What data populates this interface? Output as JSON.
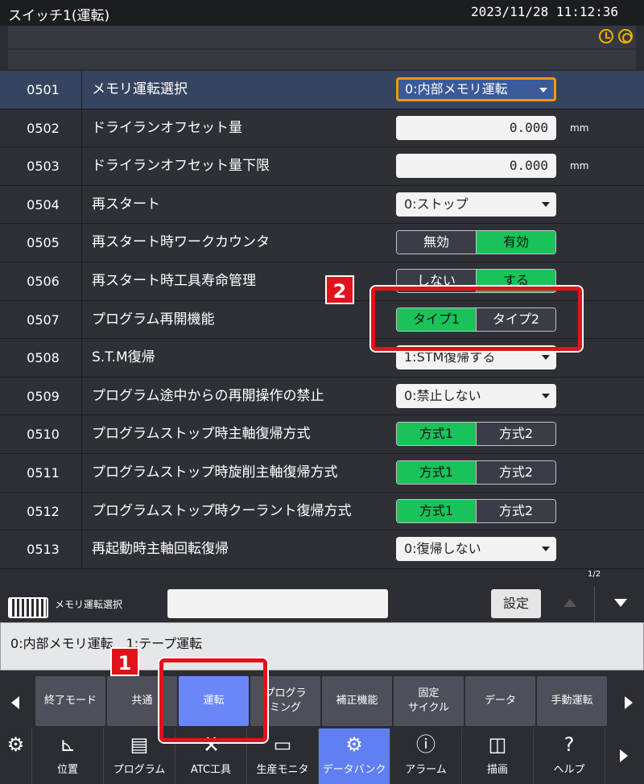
{
  "window": {
    "title": "スイッチ1(運転)",
    "datetime": "2023/11/28 11:12:36"
  },
  "rows": [
    {
      "num": "0501",
      "name": "メモリ運転選択",
      "kind": "dropdown",
      "value": "0:内部メモリ運転",
      "active": true
    },
    {
      "num": "0502",
      "name": "ドライランオフセット量",
      "kind": "number",
      "value": "0.000",
      "unit": "mm"
    },
    {
      "num": "0503",
      "name": "ドライランオフセット量下限",
      "kind": "number",
      "value": "0.000",
      "unit": "mm"
    },
    {
      "num": "0504",
      "name": "再スタート",
      "kind": "dropdown",
      "value": "0:ストップ"
    },
    {
      "num": "0505",
      "name": "再スタート時ワークカウンタ",
      "kind": "toggle",
      "opt1": "無効",
      "opt2": "有効",
      "selected": 2
    },
    {
      "num": "0506",
      "name": "再スタート時工具寿命管理",
      "kind": "toggle",
      "opt1": "しない",
      "opt2": "する",
      "selected": 2
    },
    {
      "num": "0507",
      "name": "プログラム再開機能",
      "kind": "toggle",
      "opt1": "タイプ1",
      "opt2": "タイプ2",
      "selected": 1
    },
    {
      "num": "0508",
      "name": "S.T.M復帰",
      "kind": "dropdown",
      "value": "1:STM復帰する"
    },
    {
      "num": "0509",
      "name": "プログラム途中からの再開操作の禁止",
      "kind": "dropdown",
      "value": "0:禁止しない"
    },
    {
      "num": "0510",
      "name": "プログラムストップ時主軸復帰方式",
      "kind": "toggle",
      "opt1": "方式1",
      "opt2": "方式2",
      "selected": 1
    },
    {
      "num": "0511",
      "name": "プログラムストップ時旋削主軸復帰方式",
      "kind": "toggle",
      "opt1": "方式1",
      "opt2": "方式2",
      "selected": 1
    },
    {
      "num": "0512",
      "name": "プログラムストップ時クーラント復帰方式",
      "kind": "toggle",
      "opt1": "方式1",
      "opt2": "方式2",
      "selected": 1
    },
    {
      "num": "0513",
      "name": "再起動時主軸回転復帰",
      "kind": "dropdown",
      "value": "0:復帰しない"
    }
  ],
  "input": {
    "label": "メモリ運転選択",
    "set_label": "設定",
    "page": "1/2"
  },
  "help": {
    "text": "0:内部メモリ運転　1:テープ運転"
  },
  "menu": [
    {
      "label": "終了モード"
    },
    {
      "label": "共通"
    },
    {
      "label": "運転",
      "active": true
    },
    {
      "label": "プログラ\nミング"
    },
    {
      "label": "補正機能"
    },
    {
      "label": "固定\nサイクル"
    },
    {
      "label": "データ"
    },
    {
      "label": "手動運転"
    }
  ],
  "tabs": [
    {
      "label": "位置",
      "icon": "axes-icon"
    },
    {
      "label": "プログラム",
      "icon": "program-icon"
    },
    {
      "label": "ATC工具",
      "icon": "atc-tool-icon"
    },
    {
      "label": "生産モニタ",
      "icon": "monitor-icon"
    },
    {
      "label": "データバンク",
      "icon": "gear-icon",
      "active": true
    },
    {
      "label": "アラーム",
      "icon": "alarm-icon"
    },
    {
      "label": "描画",
      "icon": "cube-icon"
    },
    {
      "label": "ヘルプ",
      "icon": "help-icon"
    }
  ],
  "annotations": {
    "badge1": "1",
    "badge2": "2"
  },
  "colors": {
    "accent_green": "#19c35a",
    "active_blue": "#6b86f5",
    "highlight_orange": "#f09a00",
    "marker_red": "#e0131b"
  }
}
